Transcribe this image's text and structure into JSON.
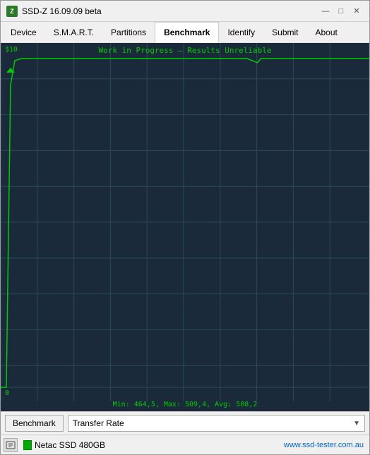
{
  "window": {
    "title": "SSD-Z  16.09.09 beta",
    "icon_label": "Z"
  },
  "titlebar": {
    "minimize_label": "—",
    "maximize_label": "□",
    "close_label": "✕"
  },
  "menu": {
    "items": [
      {
        "id": "device",
        "label": "Device"
      },
      {
        "id": "smart",
        "label": "S.M.A.R.T."
      },
      {
        "id": "partitions",
        "label": "Partitions"
      },
      {
        "id": "benchmark",
        "label": "Benchmark",
        "active": true
      },
      {
        "id": "identify",
        "label": "Identify"
      },
      {
        "id": "submit",
        "label": "Submit"
      },
      {
        "id": "about",
        "label": "About"
      }
    ]
  },
  "chart": {
    "title": "Work in Progress – Results Unreliable",
    "y_top_label": "$10",
    "y_bottom_label": "0",
    "stats": "Min: 464,5, Max: 509,4, Avg: 508,2",
    "bg_color": "#1a2a3a",
    "line_color": "#00cc00",
    "grid_color": "#2a4a5a"
  },
  "toolbar": {
    "benchmark_btn": "Benchmark",
    "dropdown_value": "Transfer Rate",
    "dropdown_arrow": "▼"
  },
  "statusbar": {
    "drive_name": "Netac SSD 480GB",
    "website": "www.ssd-tester.com.au"
  }
}
